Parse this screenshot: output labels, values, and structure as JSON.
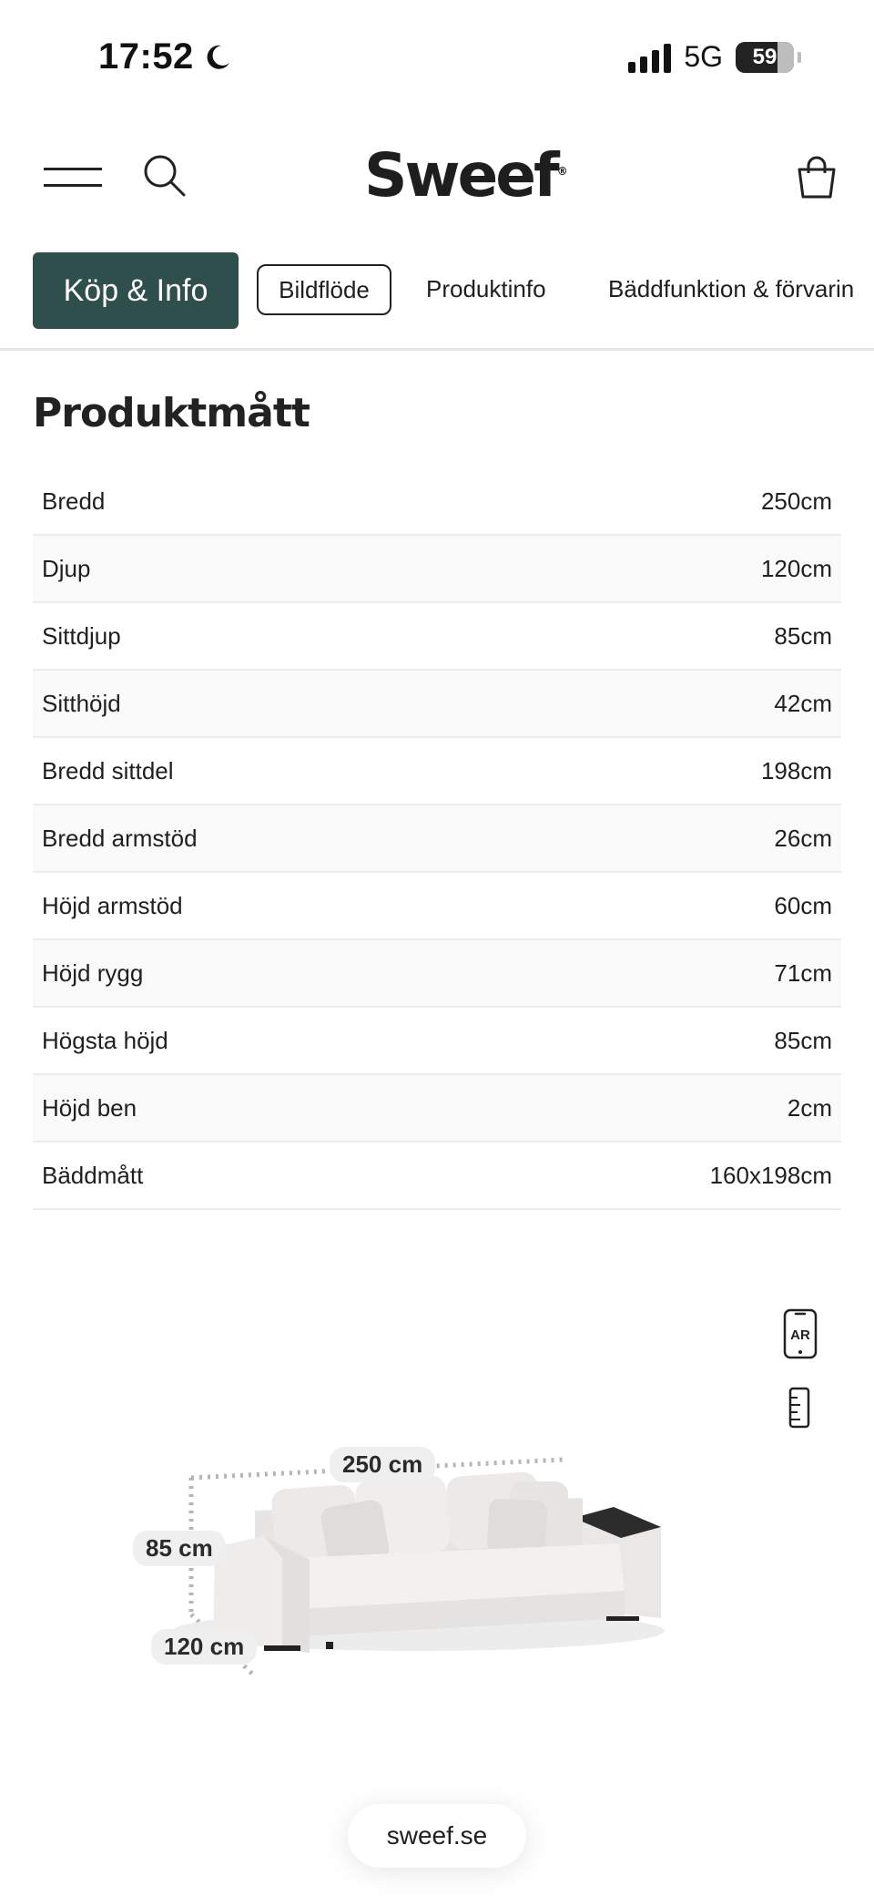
{
  "status_bar": {
    "time": "17:52",
    "network": "5G",
    "battery": "59",
    "signal_icon": "cellular-signal-icon",
    "moon_icon": "moon-icon"
  },
  "header": {
    "logo": "Sweef",
    "logo_mark": "®",
    "menu_icon": "hamburger-menu-icon",
    "search_icon": "search-icon",
    "cart_icon": "shopping-bag-icon"
  },
  "tabs": [
    {
      "label": "Köp & Info"
    },
    {
      "label": "Bildflöde"
    },
    {
      "label": "Produktinfo"
    },
    {
      "label": "Bäddfunktion & förvarin"
    }
  ],
  "section": {
    "title": "Produktmått"
  },
  "specs": [
    {
      "label": "Bredd",
      "value": "250cm"
    },
    {
      "label": "Djup",
      "value": "120cm"
    },
    {
      "label": "Sittdjup",
      "value": "85cm"
    },
    {
      "label": "Sitthöjd",
      "value": "42cm"
    },
    {
      "label": "Bredd sittdel",
      "value": "198cm"
    },
    {
      "label": "Bredd armstöd",
      "value": "26cm"
    },
    {
      "label": "Höjd armstöd",
      "value": "60cm"
    },
    {
      "label": "Höjd rygg",
      "value": "71cm"
    },
    {
      "label": "Högsta höjd",
      "value": "85cm"
    },
    {
      "label": "Höjd ben",
      "value": "2cm"
    },
    {
      "label": "Bäddmått",
      "value": "160x198cm"
    }
  ],
  "viewer": {
    "ar_label": "AR",
    "width_label": "250 cm",
    "height_label": "85 cm",
    "depth_label": "120 cm"
  },
  "footer": {
    "domain": "sweef.se"
  }
}
